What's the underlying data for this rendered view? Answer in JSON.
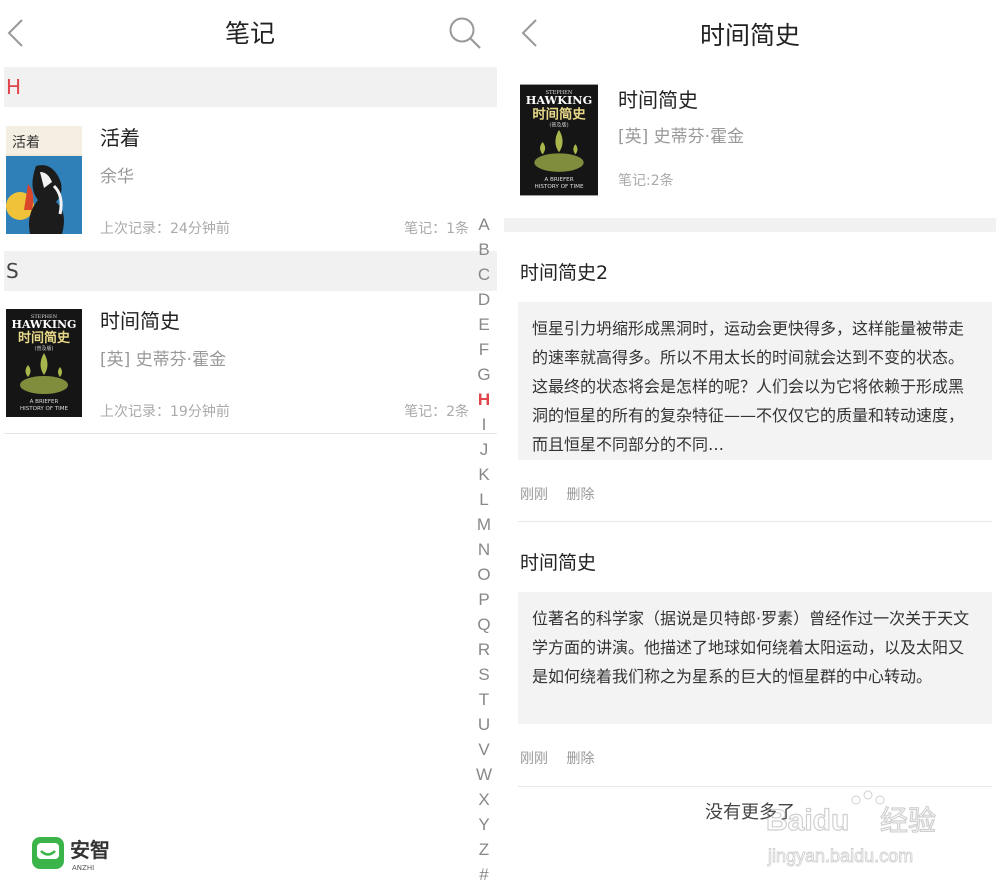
{
  "left": {
    "title": "笔记",
    "icons": {
      "back": "chevron-left-icon",
      "search": "search-icon"
    },
    "sections": [
      {
        "letter": "H",
        "books": [
          {
            "title": "活着",
            "author": "余华",
            "last_record": "上次记录：24分钟前",
            "notes": "笔记：1条",
            "cover": {
              "title": "活着",
              "colors": [
                "#1f6ea8",
                "#d9462b",
                "#f0d98a"
              ]
            }
          }
        ]
      },
      {
        "letter": "S",
        "books": [
          {
            "title": "时间简史",
            "author": "[英] 史蒂芬·霍金",
            "last_record": "上次记录：19分钟前",
            "notes": "笔记：2条",
            "cover": {
              "top": "STEPHEN",
              "name": "HAWKING",
              "title": "时间简史",
              "sub": "(普及版)",
              "en1": "A BRIEFER",
              "en2": "HISTORY OF TIME"
            }
          }
        ]
      }
    ],
    "alphabet": [
      "A",
      "B",
      "C",
      "D",
      "E",
      "F",
      "G",
      "H",
      "I",
      "J",
      "K",
      "L",
      "M",
      "N",
      "O",
      "P",
      "Q",
      "R",
      "S",
      "T",
      "U",
      "V",
      "W",
      "X",
      "Y",
      "Z",
      "#"
    ],
    "alphabet_active": "H"
  },
  "right": {
    "title": "时间简史",
    "icons": {
      "back": "chevron-left-icon"
    },
    "book": {
      "title": "时间简史",
      "author": "[英] 史蒂芬·霍金",
      "count": "笔记:2条",
      "cover": {
        "top": "STEPHEN",
        "name": "HAWKING",
        "title": "时间简史",
        "sub": "(普及版)",
        "en1": "A BRIEFER",
        "en2": "HISTORY OF TIME"
      }
    },
    "notes": [
      {
        "title": "时间简史2",
        "text": "恒星引力坍缩形成黑洞时，运动会更快得多，这样能量被带走的速率就高得多。所以不用太长的时间就会达到不变的状态。这最终的状态将会是怎样的呢？人们会以为它将依赖于形成黑洞的恒星的所有的复杂特征——不仅仅它的质量和转动速度，而且恒星不同部分的不同…",
        "time": "刚刚",
        "delete": "删除"
      },
      {
        "title": "时间简史",
        "text": "位著名的科学家（据说是贝特郎·罗素）曾经作过一次关于天文学方面的讲演。他描述了地球如何绕着太阳运动，以及太阳又是如何绕着我们称之为星系的巨大的恒星群的中心转动。",
        "time": "刚刚",
        "delete": "删除"
      }
    ],
    "footer": "没有更多了"
  },
  "watermarks": {
    "anzhi": {
      "cn": "安智",
      "en": "ANZHI",
      "color": "#3bb54a"
    },
    "baidu": {
      "brand": "Baidu",
      "cn": "经验",
      "url": "jingyan.baidu.com"
    }
  },
  "colors": {
    "accent": "#e0454b",
    "section_bg": "#f1f1f1",
    "note_bg": "#f3f3f3"
  }
}
